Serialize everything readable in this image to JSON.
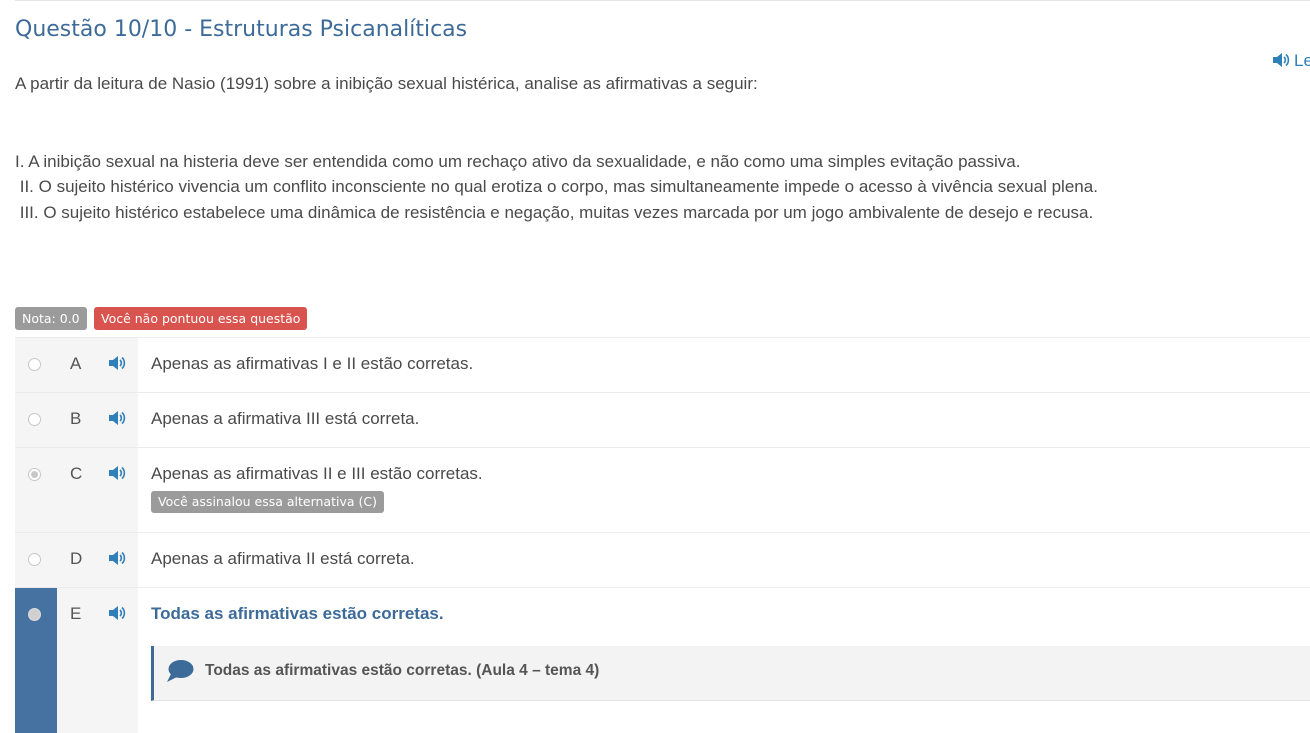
{
  "question": {
    "title": "Questão 10/10 - Estruturas Psicanalíticas",
    "listen_label": "Le",
    "intro": "A partir da leitura de Nasio (1991) sobre a inibição sexual histérica, analise as afirmativas a seguir:",
    "statements": [
      "I. A inibição sexual na histeria deve ser entendida como um rechaço ativo da sexualidade, e não como uma simples evitação passiva.",
      "II. O sujeito histérico vivencia um conflito inconsciente no qual erotiza o corpo, mas simultaneamente impede o acesso à vivência sexual plena.",
      "III. O sujeito histérico estabelece uma dinâmica de resistência e negação, muitas vezes marcada por um jogo ambivalente de desejo e recusa."
    ]
  },
  "badges": {
    "score": "Nota: 0.0",
    "status": "Você não pontuou essa questão"
  },
  "options": [
    {
      "letter": "A",
      "text": "Apenas as afirmativas I e II estão corretas."
    },
    {
      "letter": "B",
      "text": "Apenas a afirmativa III está correta."
    },
    {
      "letter": "C",
      "text": "Apenas as afirmativas II e III estão corretas.",
      "marked_label": "Você assinalou essa alternativa (C)"
    },
    {
      "letter": "D",
      "text": "Apenas a afirmativa II está correta."
    },
    {
      "letter": "E",
      "text": "Todas as afirmativas estão corretas.",
      "feedback": "Todas as afirmativas estão corretas. (Aula 4 – tema 4)"
    }
  ],
  "colors": {
    "accent": "#3d6b99",
    "correct_bar": "#4672a2",
    "error_badge": "#d9534f",
    "neutral_badge": "#9b9b9b",
    "speaker_icon": "#2f7fb8"
  },
  "icons": {
    "listen": "speaker-icon",
    "option_audio": "speaker-icon",
    "feedback": "comment-icon"
  }
}
